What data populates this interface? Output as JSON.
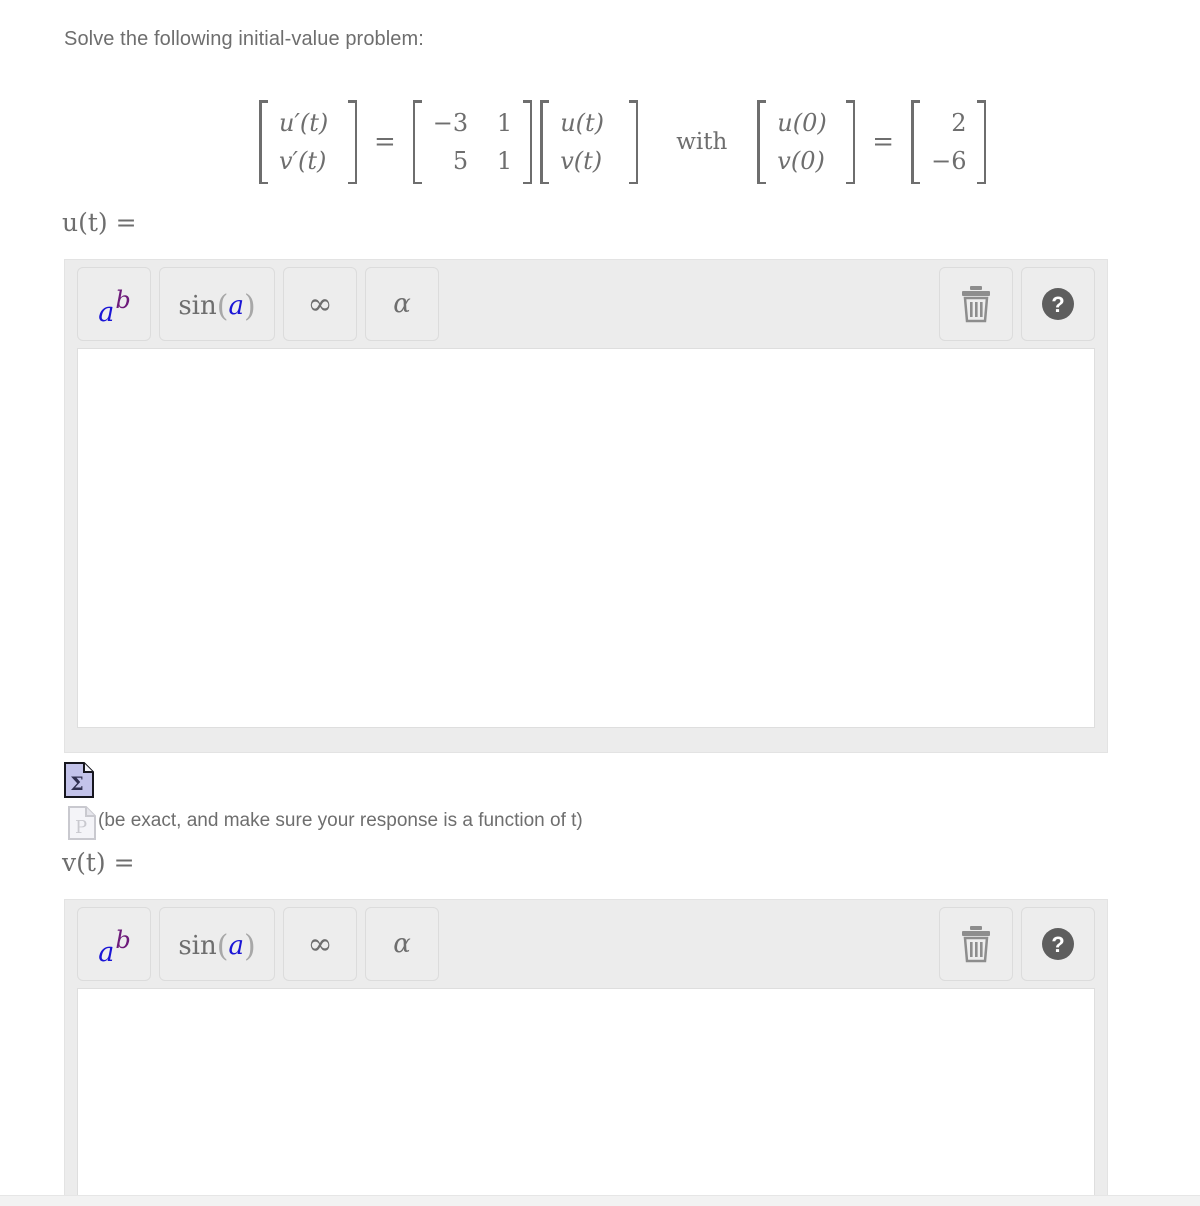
{
  "page": {
    "prompt": "Solve the following initial-value problem:"
  },
  "equation": {
    "lhs_vector": [
      "u′(t)",
      "v′(t)"
    ],
    "equals": "=",
    "coefficient_matrix": [
      [
        "−3",
        "1"
      ],
      [
        "5",
        "1"
      ]
    ],
    "state_vector": [
      "u(t)",
      "v(t)"
    ],
    "with_word": "with",
    "initial_vector_labels": [
      "u(0)",
      "v(0)"
    ],
    "initial_equals": "=",
    "initial_values": [
      "2",
      "−6"
    ]
  },
  "answers": [
    {
      "label": "u(t) =",
      "value": "",
      "toolbar": {
        "buttons": [
          {
            "name": "exponent",
            "base": "a",
            "exp": "b"
          },
          {
            "name": "sine",
            "fn": "sin",
            "open": "(",
            "arg": "a",
            "close": ")"
          },
          {
            "name": "infinity",
            "glyph": "∞"
          },
          {
            "name": "greek-alpha",
            "glyph": "α"
          }
        ],
        "trash_label": "trash-icon",
        "help_label": "?"
      }
    },
    {
      "label": "v(t) =",
      "value": "",
      "toolbar": {
        "buttons": [
          {
            "name": "exponent",
            "base": "a",
            "exp": "b"
          },
          {
            "name": "sine",
            "fn": "sin",
            "open": "(",
            "arg": "a",
            "close": ")"
          },
          {
            "name": "infinity",
            "glyph": "∞"
          },
          {
            "name": "greek-alpha",
            "glyph": "α"
          }
        ],
        "trash_label": "trash-icon",
        "help_label": "?"
      }
    }
  ],
  "hint": {
    "text": "(be exact, and make sure your response is a function of t)",
    "sigma_icon_alt": "Σ",
    "p_icon_alt": "P"
  },
  "colors": {
    "panel_bg": "#ececec",
    "button_bg": "#ededed",
    "border": "#dcdcdc",
    "text": "#6e6e6e",
    "accent_blue": "#1a15d6",
    "accent_purple": "#6d1a7a",
    "icon_lavender": "#c3c3ea"
  }
}
